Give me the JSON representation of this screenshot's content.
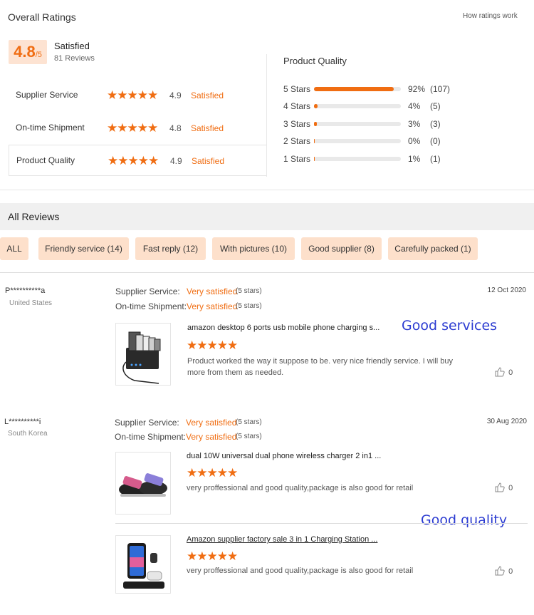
{
  "overall": {
    "title": "Overall Ratings",
    "how_link": "How ratings work",
    "score": "4.8",
    "score_max": "/5",
    "satisfaction": "Satisfied",
    "reviews": "81 Reviews",
    "metrics": [
      {
        "label": "Supplier Service",
        "stars": "★★★★★",
        "value": "4.9",
        "word": "Satisfied"
      },
      {
        "label": "On-time Shipment",
        "stars": "★★★★★",
        "value": "4.8",
        "word": "Satisfied"
      },
      {
        "label": "Product Quality",
        "stars": "★★★★★",
        "value": "4.9",
        "word": "Satisfied"
      }
    ]
  },
  "product_quality": {
    "title": "Product Quality",
    "rows": [
      {
        "label": "5 Stars",
        "fraction": 0.92,
        "pct": "92%",
        "count": "(107)"
      },
      {
        "label": "4 Stars",
        "fraction": 0.04,
        "pct": "4%",
        "count": "(5)"
      },
      {
        "label": "3 Stars",
        "fraction": 0.03,
        "pct": "3%",
        "count": "(3)"
      },
      {
        "label": "2 Stars",
        "fraction": 0.0,
        "pct": "0%",
        "count": "(0)"
      },
      {
        "label": "1 Stars",
        "fraction": 0.01,
        "pct": "1%",
        "count": "(1)"
      }
    ]
  },
  "all_reviews": {
    "title": "All Reviews",
    "filters": [
      "ALL",
      "Friendly service (14)",
      "Fast reply (12)",
      "With pictures (10)",
      "Good supplier (8)",
      "Carefully packed (1)"
    ]
  },
  "reviews": [
    {
      "user": "P**********a",
      "country": "United States",
      "date": "12 Oct 2020",
      "supplier_label": "Supplier Service:",
      "supplier_value": "Very satisfied",
      "supplier_stars": "(5 stars)",
      "shipment_label": "On-time Shipment:",
      "shipment_value": "Very satisfied",
      "shipment_stars": "(5 stars)",
      "products": [
        {
          "title": "amazon desktop 6 ports usb mobile phone charging s...",
          "stars": "★★★★★",
          "text": "Product worked the way it suppose to be. very nice friendly service. I will buy more from them as needed.",
          "likes": "0"
        }
      ]
    },
    {
      "user": "L**********i",
      "country": "South Korea",
      "date": "30 Aug 2020",
      "supplier_label": "Supplier Service:",
      "supplier_value": "Very satisfied",
      "supplier_stars": "(5 stars)",
      "shipment_label": "On-time Shipment:",
      "shipment_value": "Very satisfied",
      "shipment_stars": "(5 stars)",
      "products": [
        {
          "title": "dual 10W universal dual phone wireless charger 2 in1 ...",
          "stars": "★★★★★",
          "text": "very proffessional and good quality,package is also good for retail",
          "likes": "0"
        },
        {
          "title": "Amazon supplier factory sale 3 in 1 Charging Station ...",
          "stars": "★★★★★",
          "text": "very proffessional and good quality,package is also good for retail",
          "likes": "0"
        }
      ]
    }
  ],
  "annotations": {
    "note1": "Good services",
    "note2": "Good quality"
  },
  "colors": {
    "accent": "#f06d12",
    "chip_bg": "#fde0cb",
    "score_bg": "#fde3d2",
    "note": "#2b3bd1"
  }
}
